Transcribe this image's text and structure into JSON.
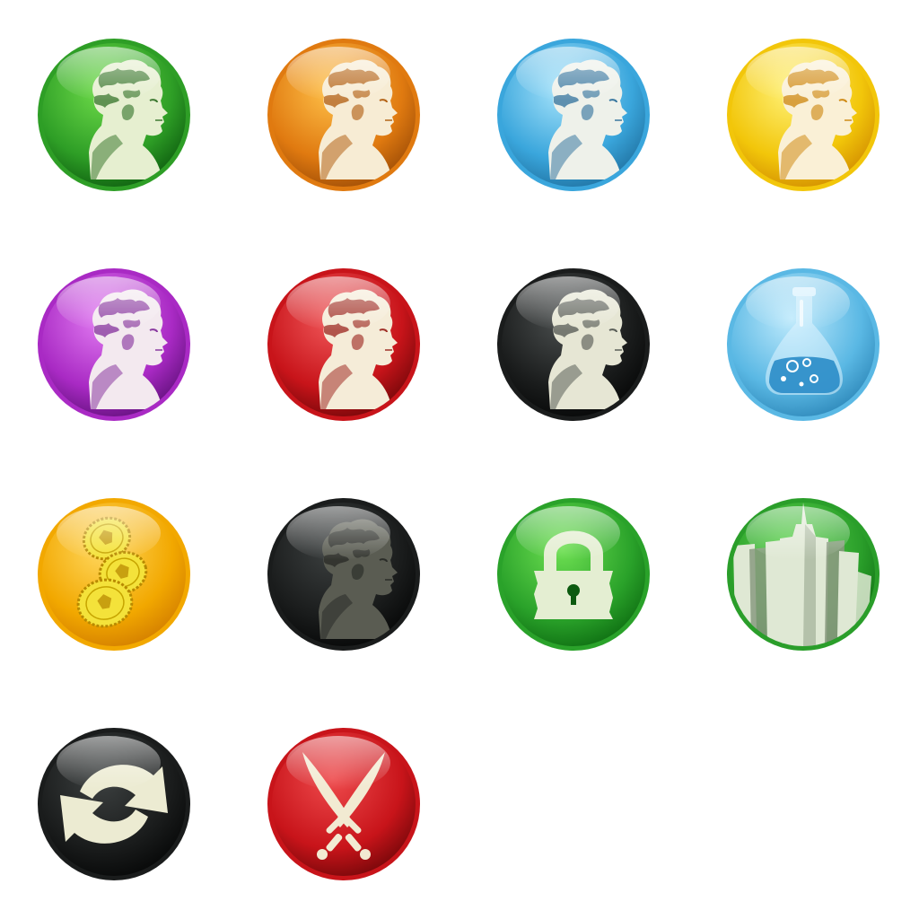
{
  "sheet": {
    "icons": [
      {
        "id": "leader-green",
        "symbol": "leader-head-icon",
        "rim": "#2e9e26",
        "light": "#6fdc4a",
        "dark": "#0c5a0e",
        "figure": "#e6efd0",
        "shade": "#3e7a32"
      },
      {
        "id": "leader-orange",
        "symbol": "leader-head-icon",
        "rim": "#e07a10",
        "light": "#ffc24a",
        "dark": "#9a4a06",
        "figure": "#f7ecd4",
        "shade": "#b46418"
      },
      {
        "id": "leader-blue",
        "symbol": "leader-head-icon",
        "rim": "#3aa6dc",
        "light": "#a8e4fb",
        "dark": "#1e6f9e",
        "figure": "#eef1ea",
        "shade": "#3a78a0"
      },
      {
        "id": "leader-yellow",
        "symbol": "leader-head-icon",
        "rim": "#f2c60a",
        "light": "#fff27a",
        "dark": "#d08a00",
        "figure": "#faf0d6",
        "shade": "#d08c18"
      },
      {
        "id": "leader-purple",
        "symbol": "leader-head-icon",
        "rim": "#a92ac4",
        "light": "#e27cf2",
        "dark": "#5e0f78",
        "figure": "#f3e9ef",
        "shade": "#8a3aa0"
      },
      {
        "id": "leader-red",
        "symbol": "leader-head-icon",
        "rim": "#c8141a",
        "light": "#f0585a",
        "dark": "#6e0608",
        "figure": "#f5ecd8",
        "shade": "#a03028"
      },
      {
        "id": "leader-black",
        "symbol": "leader-head-icon",
        "rim": "#1a1c1c",
        "light": "#4a4e4e",
        "dark": "#050606",
        "figure": "#e6e6d4",
        "shade": "#5a5e58"
      },
      {
        "id": "science",
        "symbol": "flask-icon",
        "rim": "#5ab8e4",
        "light": "#bfeafc",
        "dark": "#2a84b6",
        "figure": "#dff4ff",
        "shade": "#2a8cc8"
      },
      {
        "id": "gold",
        "symbol": "coins-icon",
        "rim": "#f2a800",
        "light": "#ffd860",
        "dark": "#d07a00",
        "figure": "#f4e23a",
        "shade": "#c8a010"
      },
      {
        "id": "leader-dim",
        "symbol": "leader-head-icon",
        "rim": "#1a1c1c",
        "light": "#3c4040",
        "dark": "#050606",
        "figure": "#5a5c52",
        "shade": "#2a2c28"
      },
      {
        "id": "lock",
        "symbol": "lock-icon",
        "rim": "#2aa22a",
        "light": "#6ee052",
        "dark": "#0c6a10",
        "figure": "#e4eed2",
        "shade": "#0c5a10"
      },
      {
        "id": "city",
        "symbol": "city-skyline-icon",
        "rim": "#2a9e2a",
        "light": "#5cd44c",
        "dark": "#0c6a10",
        "figure": "#dfe8d4",
        "shade": "#8a9a80"
      },
      {
        "id": "cycle",
        "symbol": "refresh-arrows-icon",
        "rim": "#1a1c1c",
        "light": "#3c4040",
        "dark": "#050606",
        "figure": "#ecebd2",
        "shade": "#9c9a80"
      },
      {
        "id": "war",
        "symbol": "crossed-swords-icon",
        "rim": "#c8141a",
        "light": "#ee4a4c",
        "dark": "#6e0608",
        "figure": "#f2ead2",
        "shade": "#a08868"
      }
    ]
  }
}
